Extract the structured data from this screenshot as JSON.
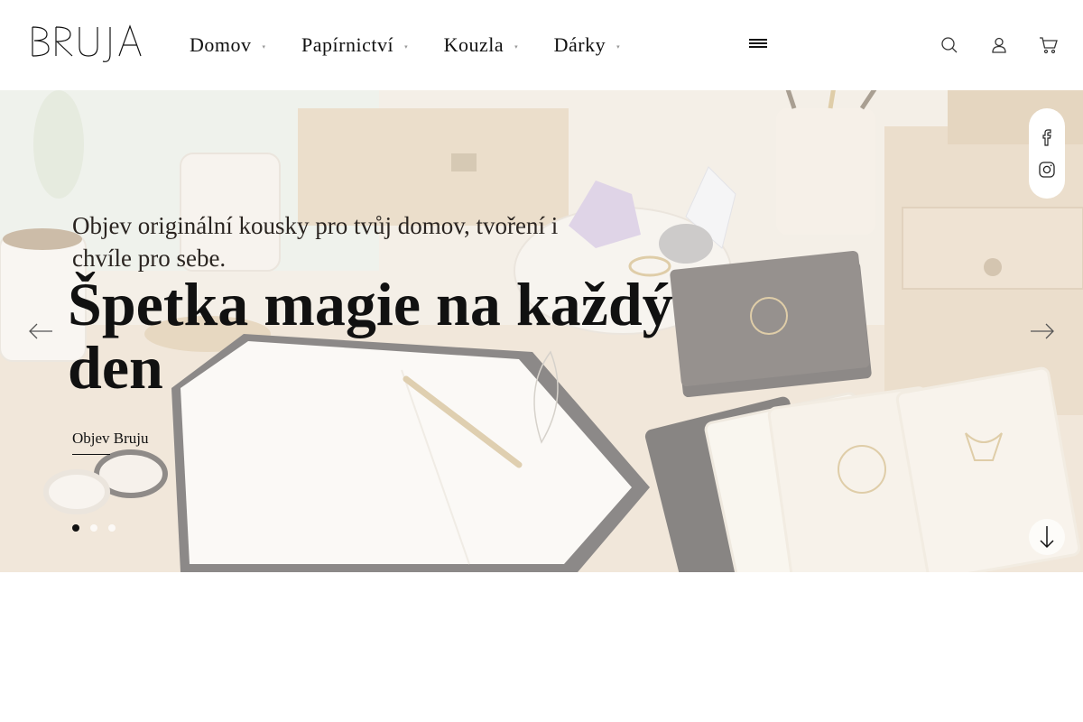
{
  "brand": {
    "name": "BRUJA"
  },
  "nav": {
    "items": [
      {
        "label": "Domov",
        "caret": "▾"
      },
      {
        "label": "Papírnictví",
        "caret": "▾"
      },
      {
        "label": "Kouzla",
        "caret": "▾"
      },
      {
        "label": "Dárky",
        "caret": "▾"
      }
    ]
  },
  "header_icons": [
    "hamburger-menu-icon",
    "search-icon",
    "user-icon",
    "cart-icon"
  ],
  "hero": {
    "subtitle": "Objev originální kousky pro tvůj domov, tvoření i chvíle pro sebe.",
    "title": "Špetka magie na každý den",
    "cta": "Objev Bruju",
    "slides": {
      "count": 3,
      "active": 1
    }
  },
  "social": [
    "facebook-icon",
    "instagram-icon"
  ],
  "colors": {
    "text": "#111111",
    "background": "#ffffff",
    "hero_bg": "#efe6da"
  }
}
